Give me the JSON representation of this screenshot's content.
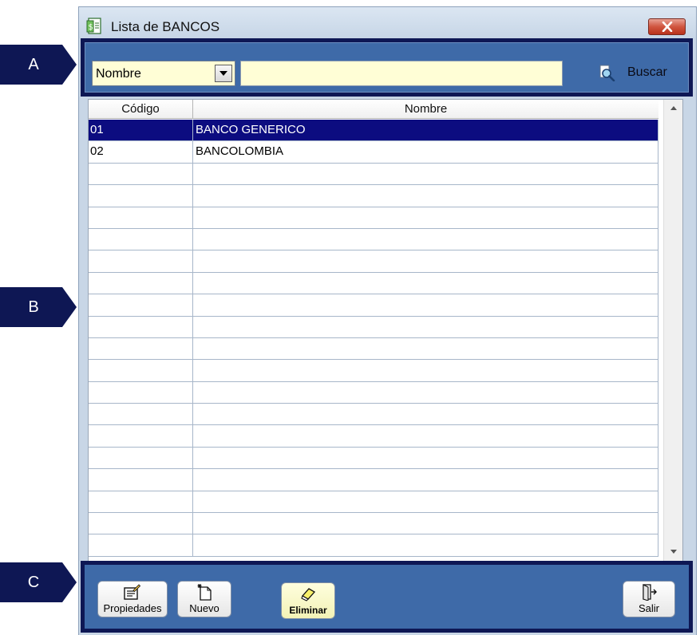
{
  "callouts": [
    {
      "label": "A"
    },
    {
      "label": "B"
    },
    {
      "label": "C"
    }
  ],
  "window": {
    "title": "Lista de BANCOS",
    "title_icon": "list-document-icon",
    "close_icon": "close-x-icon"
  },
  "search": {
    "field_selected": "Nombre",
    "field_options": [
      "Nombre"
    ],
    "query_value": "",
    "query_placeholder": "",
    "button_label": "Buscar",
    "button_icon": "magnifier-search-icon"
  },
  "grid": {
    "columns": [
      "Código",
      "Nombre"
    ],
    "rows": [
      {
        "codigo": "01",
        "nombre": "BANCO GENERICO",
        "selected": true
      },
      {
        "codigo": "02",
        "nombre": "BANCOLOMBIA",
        "selected": false
      }
    ],
    "empty_rows": 18
  },
  "toolbar": {
    "propiedades_label": "Propiedades",
    "nuevo_label": "Nuevo",
    "eliminar_label": "Eliminar",
    "salir_label": "Salir"
  },
  "colors": {
    "callout": "#0e1754",
    "panel": "#3e6aa8",
    "input_bg": "#fffed6",
    "selection": "#0c0c80",
    "close_button": "#d0553f"
  }
}
